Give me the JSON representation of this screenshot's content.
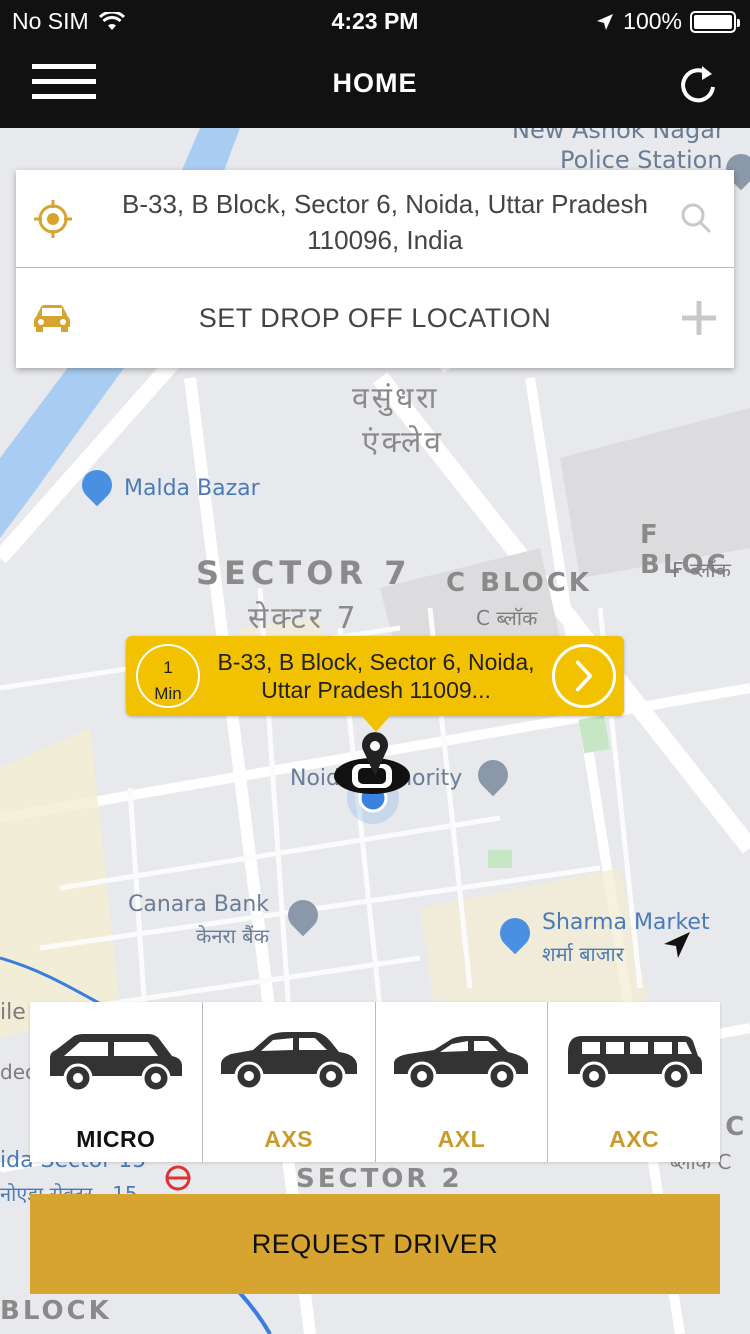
{
  "status_bar": {
    "carrier": "No SIM",
    "time": "4:23 PM",
    "battery_percent": "100%"
  },
  "header": {
    "title": "HOME",
    "menu_icon": "hamburger-menu-icon",
    "refresh_icon": "refresh-icon"
  },
  "location_card": {
    "pickup_address": "B-33, B Block, Sector 6, Noida, Uttar Pradesh 110096, India",
    "dropoff_placeholder": "SET DROP OFF LOCATION"
  },
  "map": {
    "labels": {
      "police_station_line1": "New Ashok Nagar",
      "police_station_line2": "Police Station",
      "vasundhara_1": "वसुंधरा",
      "vasundhara_2": "एंक्लेव",
      "malda_bazar": "Malda Bazar",
      "sector7": "SECTOR 7",
      "sector7_hi": "सेक्टर 7",
      "c_block": "C BLOCK",
      "c_block_hi": "C ब्लॉक",
      "f_block": "F BLOC",
      "f_block_hi": "F ब्लॉक",
      "noida_authority": "Noida Authority",
      "canara_bank": "Canara Bank",
      "canara_bank_hi": "केनरा बैंक",
      "sharma_market": "Sharma Market",
      "sharma_market_hi": "शर्मा बाजार",
      "sector2": "SECTOR 2",
      "block_bottom": "BLOCK",
      "left_frag1": "ile",
      "left_frag2": "dec",
      "left_frag3": "ida Sector 15",
      "left_frag4": "नोएडा सेक्टर - 15",
      "right_frag1": "K C",
      "right_frag2": "ब्लॉक C"
    }
  },
  "callout": {
    "eta_value": "1",
    "eta_unit": "Min",
    "address": "B-33, B Block, Sector 6, Noida, Uttar Pradesh 11009..."
  },
  "vehicles": [
    {
      "label": "MICRO",
      "icon": "hatchback-car-icon",
      "selected": true
    },
    {
      "label": "AXS",
      "icon": "sedan-car-icon",
      "selected": false
    },
    {
      "label": "AXL",
      "icon": "large-sedan-car-icon",
      "selected": false
    },
    {
      "label": "AXC",
      "icon": "van-icon",
      "selected": false
    }
  ],
  "request_button": {
    "label": "REQUEST DRIVER"
  },
  "colors": {
    "accent_gold": "#d6a42f",
    "callout_yellow": "#f2c200",
    "header_black": "#111111"
  }
}
